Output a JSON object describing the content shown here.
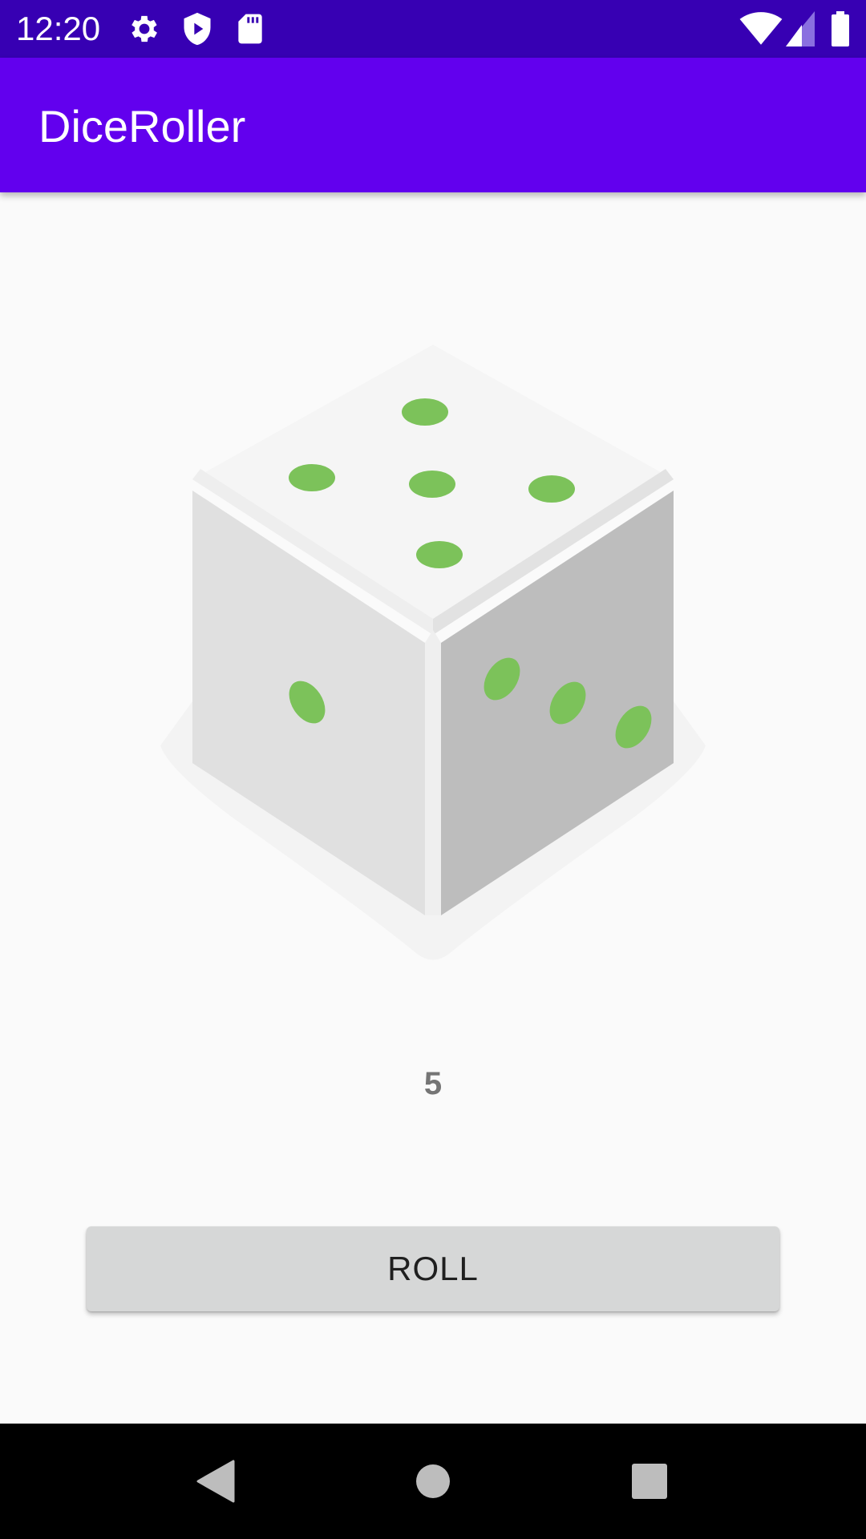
{
  "status_bar": {
    "time": "12:20",
    "left_icons": [
      "gear-icon",
      "shield-play-icon",
      "sd-card-icon"
    ],
    "right_icons": [
      "wifi-icon",
      "cellular-signal-icon",
      "battery-icon"
    ],
    "background": "#3700b3"
  },
  "app_bar": {
    "title": "DiceRoller",
    "background": "#6200ee"
  },
  "dice": {
    "icon": "dice-icon",
    "top_face_pips": 5,
    "left_face_pips": 1,
    "right_face_pips": 3,
    "pip_color": "#7cc25a"
  },
  "result": {
    "value": "5"
  },
  "roll_button": {
    "label": "ROLL"
  },
  "nav_bar": {
    "buttons": [
      "back-icon",
      "home-icon",
      "recents-icon"
    ]
  }
}
